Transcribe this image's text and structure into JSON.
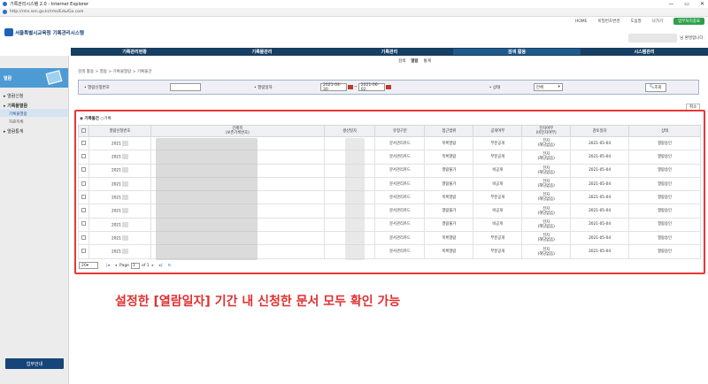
{
  "window": {
    "title": "기록관리시스템 2.0 - Internet Explorer",
    "url": "http://rms.sen.go.kr/rms/Edu/Go.com",
    "controls": [
      "—",
      "▭",
      "✕"
    ]
  },
  "topnav": {
    "links": [
      "HOME",
      "비밀번호변경",
      "도움말",
      "나가기"
    ],
    "logout": "업무처리종료"
  },
  "logo": {
    "org": "서울특별시교육청",
    "system": "기록관리시스템"
  },
  "user": {
    "greeting": "님 환영합니다."
  },
  "gnb": {
    "items": [
      "기록관리현황",
      "기록물관리",
      "기록관리",
      "검색 활용",
      "시스템관리"
    ],
    "active": "검색 활용"
  },
  "subgnb": {
    "items": [
      "검색",
      "열람",
      "통계"
    ],
    "active": "열람"
  },
  "sidebar": {
    "header": "열람",
    "items": [
      {
        "label": "열람신청",
        "sub": []
      },
      {
        "label": "기록물열람",
        "sub": [
          "기록물열람",
          "자료목록"
        ]
      },
      {
        "label": "열람통계",
        "sub": []
      }
    ],
    "guide": "업무안내"
  },
  "breadcrumb": "검색 활용 > 열람 > 기록물열람 > 기록물건",
  "search": {
    "app_no_label": "열람신청번호",
    "app_no_value": "",
    "date_label": "열람일자",
    "date_from": "2021-04-30",
    "date_to": "2021-06-02",
    "tilde": "~",
    "status_label": "상태",
    "status_value": "전체",
    "search_btn": "조회"
  },
  "cancel_btn": "취소",
  "tabs": {
    "active": "기록물건",
    "other": "기록"
  },
  "table": {
    "headers": [
      "열람신청번호",
      "건제목\n(보존기록번호)",
      "생산일자",
      "유형구분",
      "접근범위",
      "공개여부",
      "전자여부\n(비전자여부)",
      "검토일자",
      "상태"
    ],
    "rows": [
      {
        "no": "2021",
        "type": "문서관리카드",
        "access": "목록열람",
        "open": "부분공개",
        "elec": "전자\n(해당없음)",
        "date": "2021-05-04",
        "status": "열람승인"
      },
      {
        "no": "2021",
        "type": "문서관리카드",
        "access": "목록열람",
        "open": "부분공개",
        "elec": "전자\n(해당없음)",
        "date": "2021-05-04",
        "status": "열람승인"
      },
      {
        "no": "2021",
        "type": "문서관리카드",
        "access": "열람불가",
        "open": "비공개",
        "elec": "전자\n(해당없음)",
        "date": "2021-05-04",
        "status": "열람승인"
      },
      {
        "no": "2021",
        "type": "문서관리카드",
        "access": "열람불가",
        "open": "비공개",
        "elec": "전자\n(해당없음)",
        "date": "2021-05-04",
        "status": "열람승인"
      },
      {
        "no": "2021",
        "type": "문서관리카드",
        "access": "목록열람",
        "open": "부분공개",
        "elec": "전자\n(해당없음)",
        "date": "2021-05-04",
        "status": "열람승인"
      },
      {
        "no": "2021",
        "type": "문서관리카드",
        "access": "열람불가",
        "open": "비공개",
        "elec": "전자\n(해당없음)",
        "date": "2021-05-04",
        "status": "열람승인"
      },
      {
        "no": "2021",
        "type": "문서관리카드",
        "access": "열람불가",
        "open": "비공개",
        "elec": "전자\n(해당없음)",
        "date": "2021-05-04",
        "status": "열람승인"
      },
      {
        "no": "2021",
        "type": "문서관리카드",
        "access": "목록열람",
        "open": "부분공개",
        "elec": "전자\n(해당없음)",
        "date": "2021-05-04",
        "status": "열람승인"
      },
      {
        "no": "2021",
        "type": "문서관리카드",
        "access": "목록열람",
        "open": "부분공개",
        "elec": "전자\n(해당없음)",
        "date": "2021-05-04",
        "status": "열람승인"
      }
    ]
  },
  "pager": {
    "size": "20",
    "page_label": "Page",
    "page": "1",
    "of": "of 1"
  },
  "caption": "설정한 [열람일자] 기간 내 신청한 문서 모두 확인 가능"
}
